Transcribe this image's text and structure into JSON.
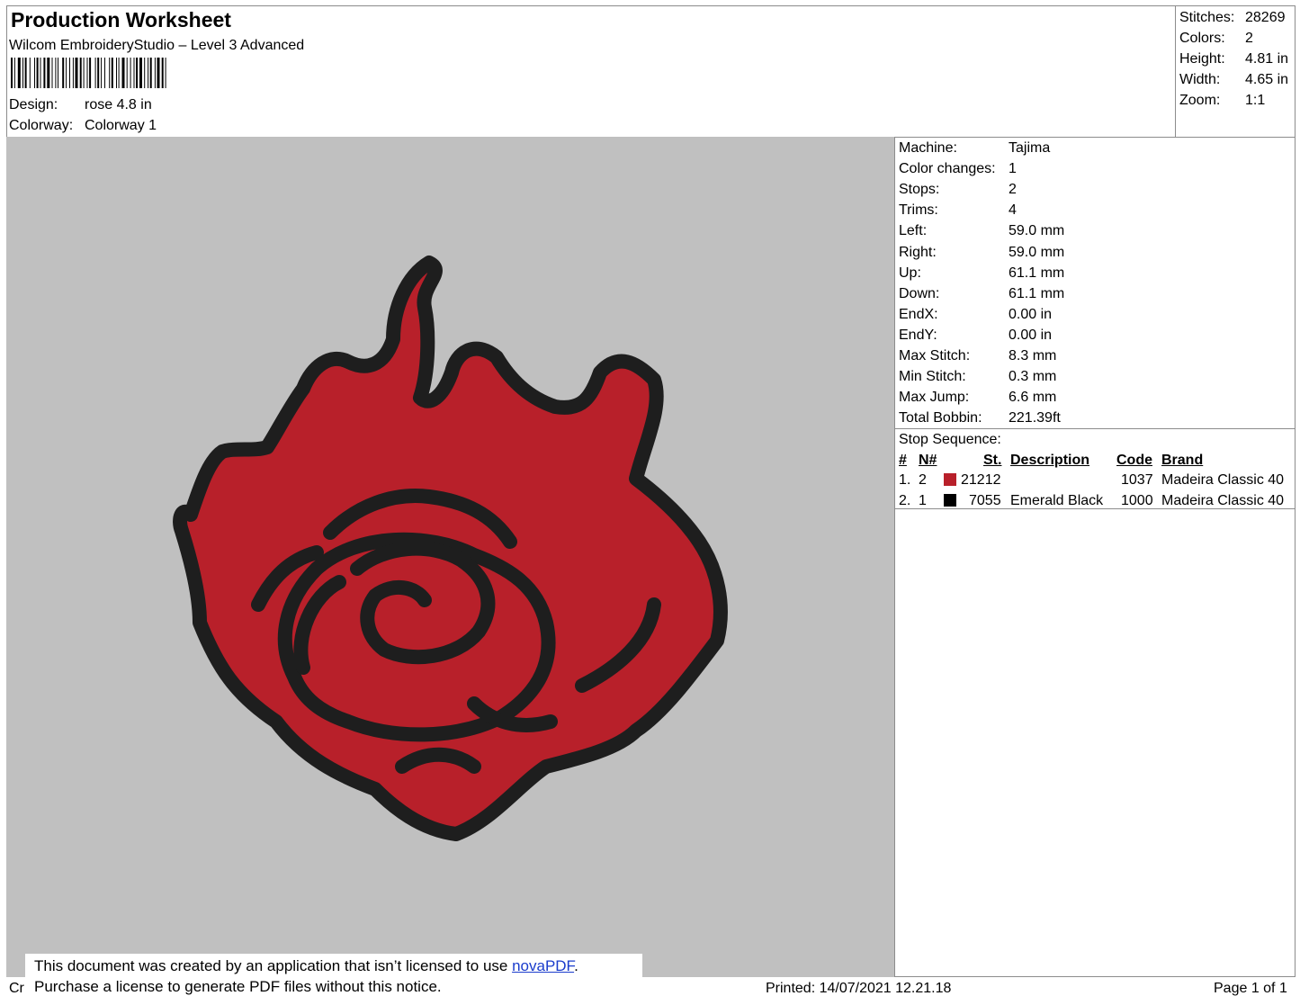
{
  "header": {
    "title": "Production Worksheet",
    "software": "Wilcom EmbroideryStudio – Level 3 Advanced",
    "design_label": "Design:",
    "design_value": "rose 4.8 in",
    "colorway_label": "Colorway:",
    "colorway_value": "Colorway 1"
  },
  "summary": [
    {
      "label": "Stitches:",
      "value": "28269"
    },
    {
      "label": "Colors:",
      "value": "2"
    },
    {
      "label": "Height:",
      "value": "4.81 in"
    },
    {
      "label": "Width:",
      "value": "4.65 in"
    },
    {
      "label": "Zoom:",
      "value": "1:1"
    }
  ],
  "machine_info": [
    {
      "label": "Machine:",
      "value": "Tajima"
    },
    {
      "label": "Color changes:",
      "value": "1"
    },
    {
      "label": "Stops:",
      "value": "2"
    },
    {
      "label": "Trims:",
      "value": "4"
    },
    {
      "label": "Left:",
      "value": "59.0 mm"
    },
    {
      "label": "Right:",
      "value": "59.0 mm"
    },
    {
      "label": "Up:",
      "value": "61.1 mm"
    },
    {
      "label": "Down:",
      "value": "61.1 mm"
    },
    {
      "label": "EndX:",
      "value": "0.00 in"
    },
    {
      "label": "EndY:",
      "value": "0.00 in"
    },
    {
      "label": "Max Stitch:",
      "value": "8.3 mm"
    },
    {
      "label": "Min Stitch:",
      "value": "0.3 mm"
    },
    {
      "label": "Max Jump:",
      "value": "6.6 mm"
    },
    {
      "label": "Total Bobbin:",
      "value": "221.39ft"
    }
  ],
  "stop_sequence": {
    "title": "Stop Sequence:",
    "headers": {
      "num": "#",
      "n": "N#",
      "st": "St.",
      "description": "Description",
      "code": "Code",
      "brand": "Brand"
    },
    "rows": [
      {
        "num": "1.",
        "n": "2",
        "color": "#b8202a",
        "st": "21212",
        "description": "",
        "code": "1037",
        "brand": "Madeira Classic 40"
      },
      {
        "num": "2.",
        "n": "1",
        "color": "#000000",
        "st": "7055",
        "description": "Emerald Black",
        "code": "1000",
        "brand": "Madeira Classic 40"
      }
    ]
  },
  "footer": {
    "left_stub": "Cr",
    "printed": "Printed: 14/07/2021 12.21.18",
    "page": "Page 1 of 1"
  },
  "notice": {
    "line1_prefix": "This document was created by an application that isn’t licensed to use ",
    "link_text": "novaPDF",
    "line1_suffix": ".",
    "line2": "Purchase a license to generate PDF files without this notice."
  },
  "colors": {
    "canvas_bg": "#c0c0c0",
    "rose_red": "#b8202a",
    "outline": "#1e1e1e"
  }
}
